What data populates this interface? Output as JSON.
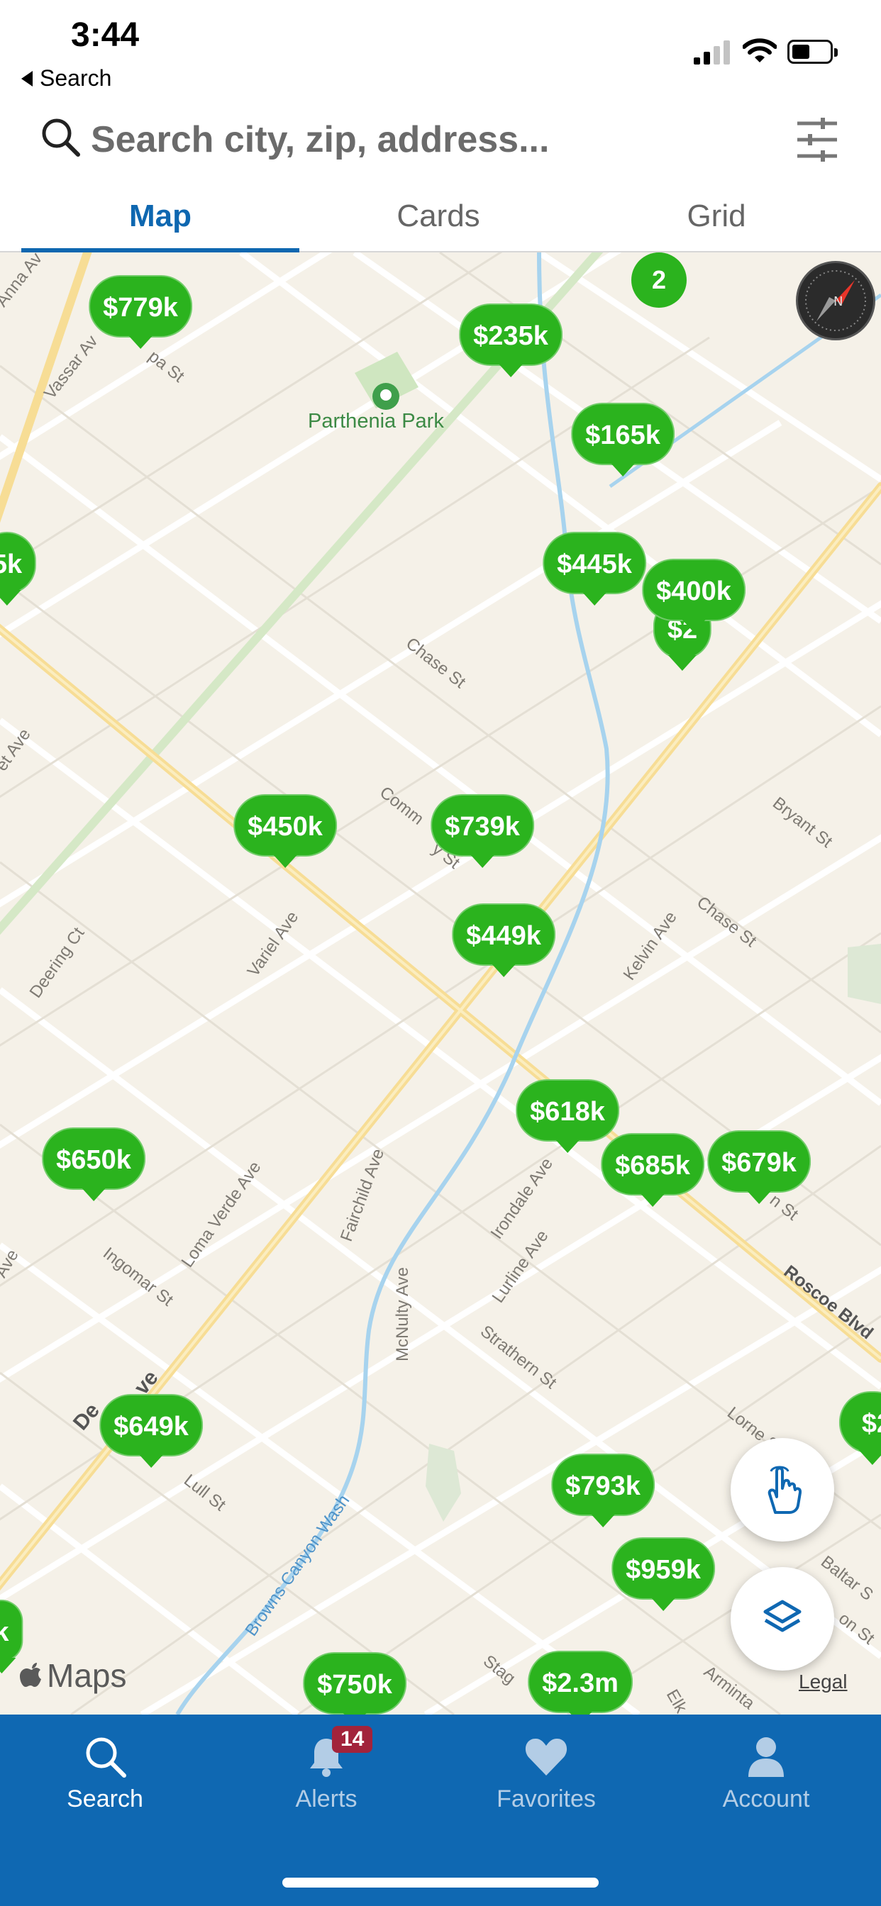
{
  "status_bar": {
    "time": "3:44",
    "back_label": "Search"
  },
  "search": {
    "placeholder": "Search city, zip, address..."
  },
  "tabs": [
    {
      "label": "Map",
      "active": true
    },
    {
      "label": "Cards",
      "active": false
    },
    {
      "label": "Grid",
      "active": false
    }
  ],
  "map": {
    "park": "Parthenia Park",
    "cluster_count": "2",
    "streets": [
      "Vassar Av",
      "Anna Av",
      "pa St",
      "Chase St",
      "Bryant St",
      "Chase St",
      "Kelvin Ave",
      "Comm",
      "y St",
      "Variel Ave",
      "Deering Ct",
      "et Ave",
      "Fairchild Ave",
      "Loma Verde Ave",
      "Ingomar St",
      "Irondale Ave",
      "Lurline Ave",
      "McNulty Ave",
      "Strathern St",
      "Roscoe Blvd",
      "Lorne S",
      "Browns Canyon Wash",
      "Lull St",
      "De",
      "ve",
      "Ave",
      "Baltar S",
      "Stag",
      "Elk",
      "Arminta",
      "n St",
      "on St"
    ],
    "pins": [
      "$779k",
      "$235k",
      "$165k",
      "5k",
      "$445k",
      "$400k",
      "$2",
      "0k",
      "$450k",
      "$739k",
      "$449k",
      "$618k",
      "$650k",
      "$685k",
      "$679k",
      "$649k",
      "$793k",
      "$959k",
      "$2",
      "$750k",
      "$2.3m",
      "k"
    ],
    "maps_label": "Maps",
    "legal_label": "Legal"
  },
  "nav": {
    "items": [
      {
        "label": "Search",
        "icon": "search-icon",
        "active": true
      },
      {
        "label": "Alerts",
        "icon": "bell-icon",
        "active": false,
        "badge": "14"
      },
      {
        "label": "Favorites",
        "icon": "heart-icon",
        "active": false
      },
      {
        "label": "Account",
        "icon": "person-icon",
        "active": false
      }
    ]
  },
  "colors": {
    "pin_green": "#2bb31e",
    "brand_blue": "#0f68b2",
    "tab_blue": "#0e67b0",
    "badge_red": "#a2233b"
  }
}
